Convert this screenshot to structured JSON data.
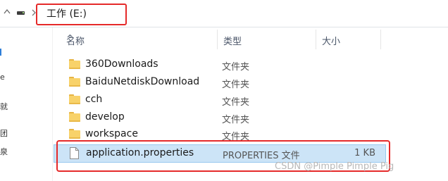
{
  "address": {
    "path": "工作 (E:)"
  },
  "nav": {
    "glyphs": [
      "e",
      "就",
      "团",
      "泉"
    ]
  },
  "columns": {
    "name": "名称",
    "type": "类型",
    "size": "大小"
  },
  "files": [
    {
      "name": "360Downloads",
      "type": "文件夹",
      "size": "",
      "icon": "folder-icon"
    },
    {
      "name": "BaiduNetdiskDownload",
      "type": "文件夹",
      "size": "",
      "icon": "folder-icon"
    },
    {
      "name": "cch",
      "type": "文件夹",
      "size": "",
      "icon": "folder-icon"
    },
    {
      "name": "develop",
      "type": "文件夹",
      "size": "",
      "icon": "folder-icon"
    },
    {
      "name": "workspace",
      "type": "文件夹",
      "size": "",
      "icon": "folder-icon"
    },
    {
      "name": "application.properties",
      "type": "PROPERTIES 文件",
      "size": "1 KB",
      "icon": "document-icon"
    }
  ],
  "watermark": "CSDN @Pimple Pimple Pig",
  "colors": {
    "highlight": "#e52a2a",
    "selection": "#cce4f7",
    "folder": "#f8d26a"
  }
}
